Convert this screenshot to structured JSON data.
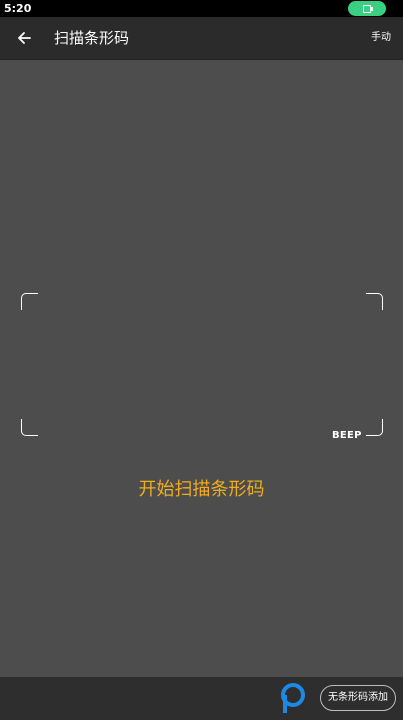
{
  "status_bar": {
    "time": "5:20"
  },
  "app_bar": {
    "title": "扫描条形码",
    "manual_label": "手动"
  },
  "scan": {
    "beep_label": "BEEP",
    "prompt": "开始扫描条形码"
  },
  "bottom_bar": {
    "no_barcode_label": "无条形码添加"
  },
  "colors": {
    "status_bar_bg": "#000000",
    "battery_pill": "#3ad081",
    "app_bar_bg": "#2b2b2b",
    "scan_area_bg": "#4d4d4d",
    "prompt_text": "#f0ad1e",
    "bottom_bar_bg": "#2e2e2e",
    "logo_blue": "#1e88e5"
  },
  "icons": {
    "back": "arrow-left-icon",
    "battery": "battery-icon",
    "logo": "logo-p-icon"
  }
}
